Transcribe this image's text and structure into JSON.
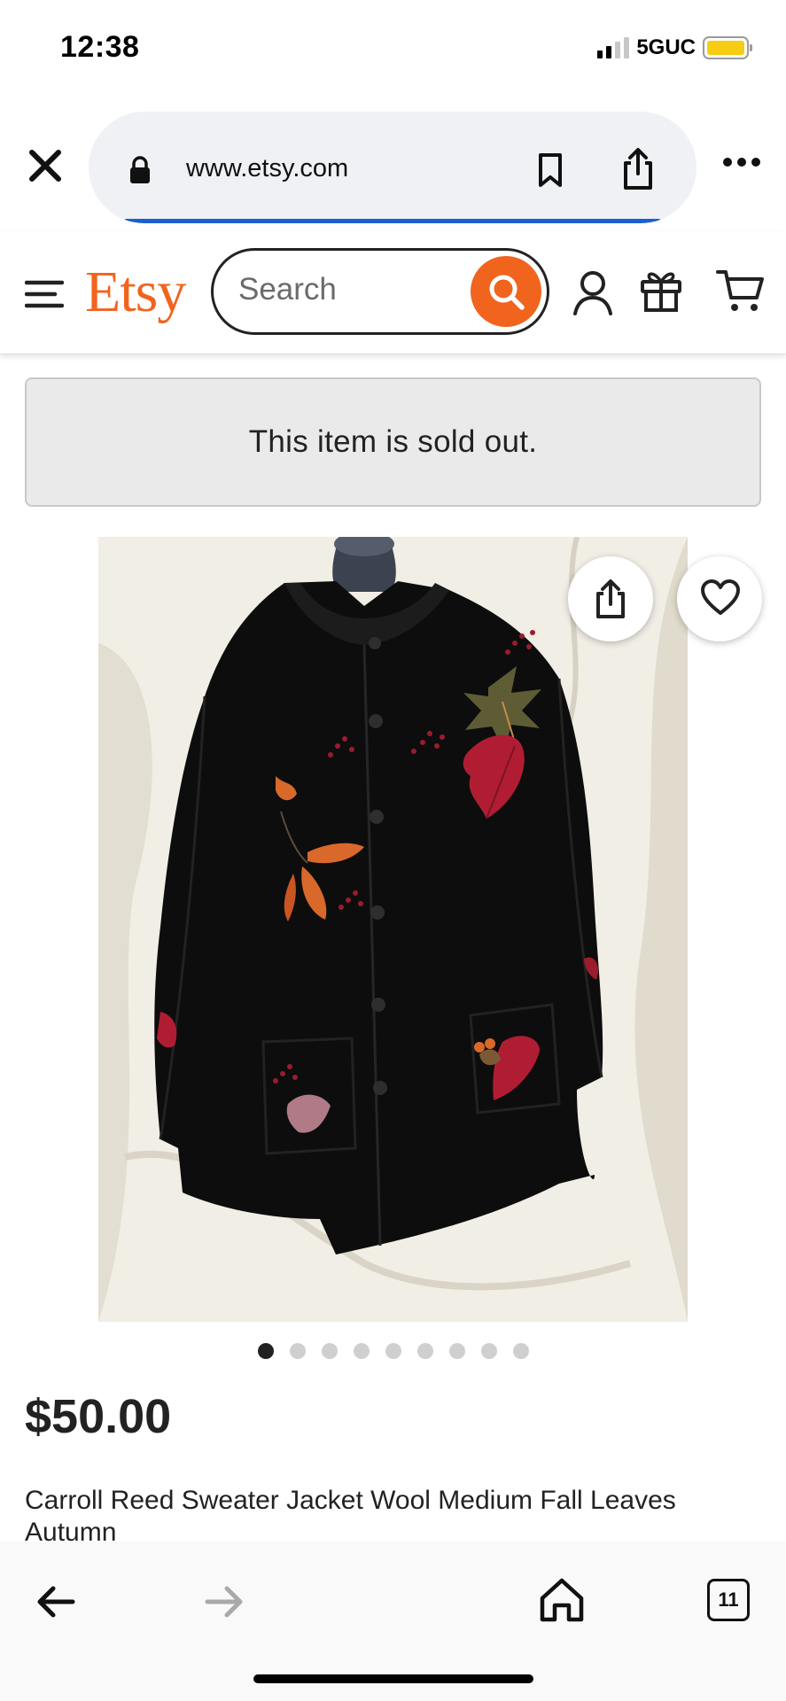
{
  "status_bar": {
    "time": "12:38",
    "network": "5GUC",
    "battery_color": "#f6cd12"
  },
  "browser": {
    "url": "www.etsy.com",
    "icons": [
      "close-icon",
      "lock-icon",
      "bookmark-icon",
      "share-icon",
      "more-icon"
    ],
    "progress_color": "#1a5fcf"
  },
  "header": {
    "logo": "Etsy",
    "brand_color": "#f1641e",
    "search_placeholder": "Search",
    "icons": [
      "menu-icon",
      "search-icon",
      "account-icon",
      "gift-icon",
      "cart-icon"
    ]
  },
  "notice": {
    "text": "This item is sold out."
  },
  "gallery": {
    "image_subject": "black wool cardigan with autumn leaf appliqués",
    "image_count": 9,
    "active_index": 0,
    "actions": [
      "share-icon",
      "heart-icon"
    ]
  },
  "product": {
    "price": "$50.00",
    "title": "Carroll Reed Sweater Jacket Wool Medium Fall Leaves Autumn"
  },
  "bottom_bar": {
    "tab_count": "11",
    "icons": [
      "back-arrow-icon",
      "forward-arrow-icon",
      "home-icon",
      "tabs-icon"
    ]
  }
}
